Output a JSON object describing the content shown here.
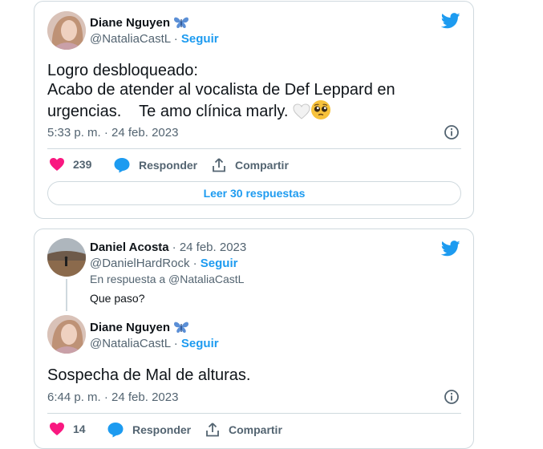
{
  "tweet1": {
    "author_name": "Diane Nguyen",
    "author_name_emoji": "butterfly-icon",
    "handle": "@NataliaCastL",
    "separator": "·",
    "follow_label": "Seguir",
    "text_line1": "Logro desbloqueado:",
    "text_line2": "Acabo de atender al vocalista de Def Leppard en",
    "text_line3": "urgencias.    Te amo clínica marly.",
    "timestamp": "5:33 p. m. · 24 feb. 2023",
    "likes": "239",
    "reply_label": "Responder",
    "share_label": "Compartir",
    "read_replies_label": "Leer 30 respuestas"
  },
  "tweet2": {
    "parent": {
      "author_name": "Daniel Acosta",
      "date": "· 24 feb. 2023",
      "handle": "@DanielHardRock",
      "separator": "·",
      "follow_label": "Seguir",
      "reply_context": "En respuesta a @NataliaCastL",
      "text": "Que paso?"
    },
    "reply": {
      "author_name": "Diane Nguyen",
      "handle": "@NataliaCastL",
      "separator": "·",
      "follow_label": "Seguir",
      "text": "Sospecha de Mal de alturas.",
      "timestamp": "6:44 p. m. · 24 feb. 2023",
      "likes": "14",
      "reply_label": "Responder",
      "share_label": "Compartir"
    }
  },
  "colors": {
    "twitter_blue": "#1d9bf0",
    "like_pink": "#f91880",
    "text_gray": "#536471",
    "border": "#cfd9de"
  }
}
